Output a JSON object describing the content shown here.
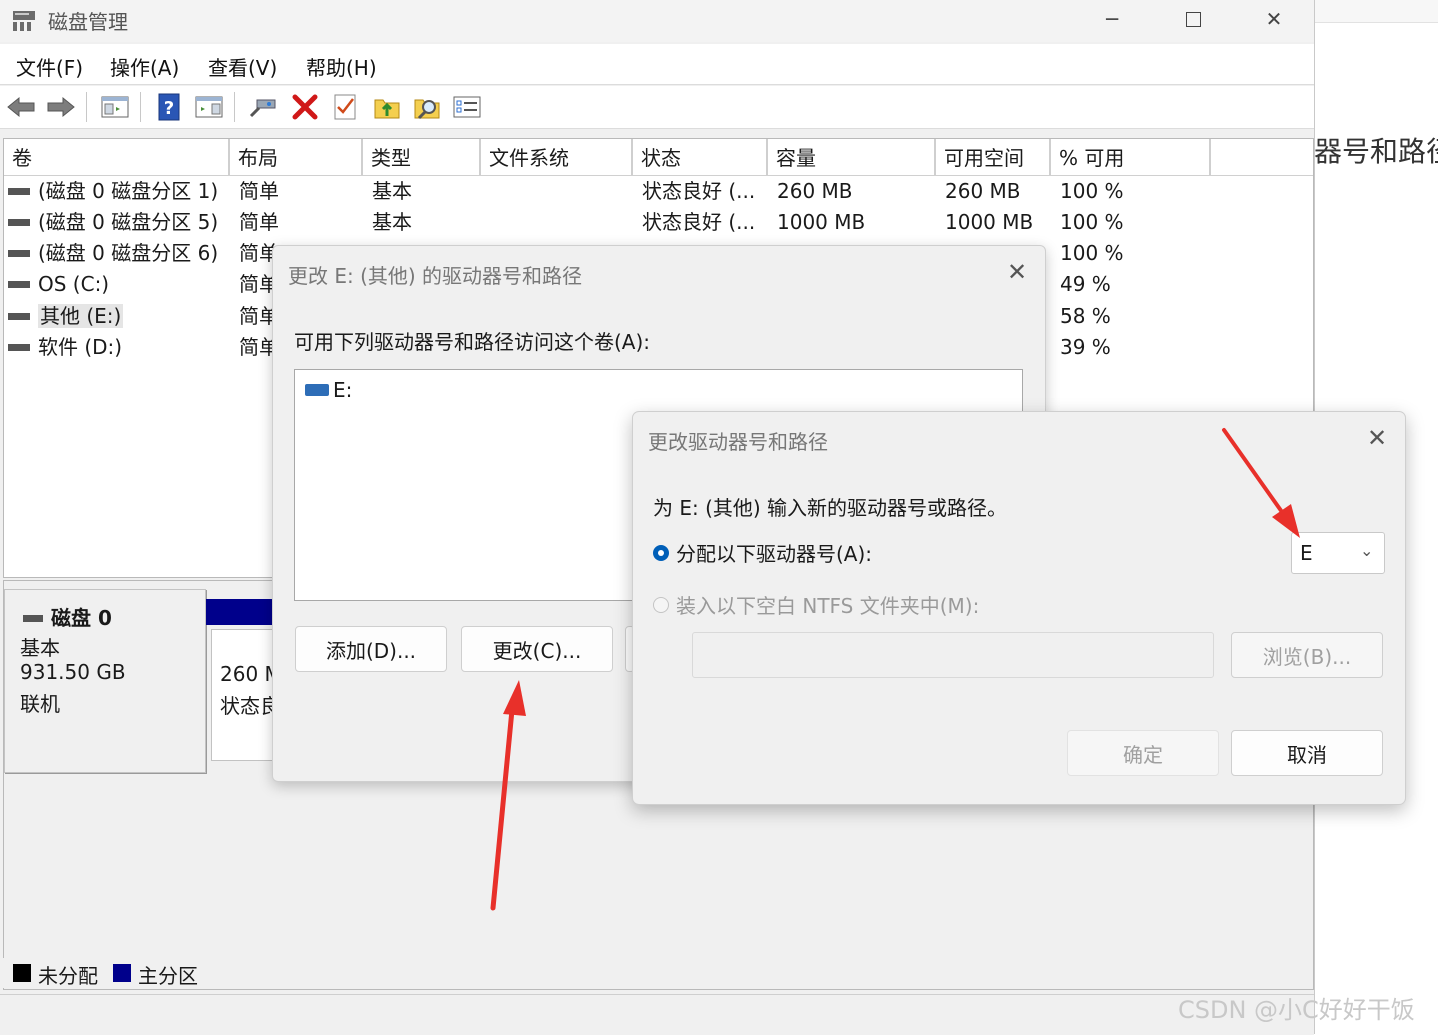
{
  "window": {
    "title": "磁盘管理",
    "menu": [
      "文件(F)",
      "操作(A)",
      "查看(V)",
      "帮助(H)"
    ]
  },
  "background_doc": {
    "text": "器号和路径"
  },
  "volume_table": {
    "headers": [
      "卷",
      "布局",
      "类型",
      "文件系统",
      "状态",
      "容量",
      "可用空间",
      "% 可用"
    ],
    "rows": [
      {
        "name": "(磁盘 0 磁盘分区 1)",
        "layout": "简单",
        "type": "基本",
        "status": "状态良好 (...",
        "capacity": "260 MB",
        "free": "260 MB",
        "pct": "100 %"
      },
      {
        "name": "(磁盘 0 磁盘分区 5)",
        "layout": "简单",
        "type": "基本",
        "status": "状态良好 (...",
        "capacity": "1000 MB",
        "free": "1000 MB",
        "pct": "100 %"
      },
      {
        "name": "(磁盘 0 磁盘分区 6)",
        "layout": "简单",
        "pct": "100 %"
      },
      {
        "name": "OS (C:)",
        "layout": "简单",
        "pct": "49 %"
      },
      {
        "name": "其他 (E:)",
        "layout": "简单",
        "pct": "58 %"
      },
      {
        "name": "软件 (D:)",
        "layout": "简单",
        "pct": "39 %"
      }
    ]
  },
  "disk": {
    "name": "磁盘 0",
    "type": "基本",
    "size": "931.50 GB",
    "state": "联机",
    "partition_size": "260 M",
    "partition_status": "状态良"
  },
  "legend": {
    "unallocated": "未分配",
    "primary": "主分区"
  },
  "colors": {
    "primary_partition": "#00008b",
    "unallocated": "#000000",
    "radio_selected": "#005fb8",
    "arrow": "#e8302a"
  },
  "dialog1": {
    "title": "更改 E: (其他) 的驱动器号和路径",
    "prompt": "可用下列驱动器号和路径访问这个卷(A):",
    "list_items": [
      "E:"
    ],
    "add_button": "添加(D)...",
    "change_button": "更改(C)..."
  },
  "dialog2": {
    "title": "更改驱动器号和路径",
    "prompt": "为 E: (其他) 输入新的驱动器号或路径。",
    "option_assign": "分配以下驱动器号(A):",
    "option_mount": "装入以下空白 NTFS 文件夹中(M):",
    "drive_letter": "E",
    "browse_button": "浏览(B)...",
    "ok_button": "确定",
    "cancel_button": "取消"
  },
  "watermark": "CSDN @小C好好干饭"
}
